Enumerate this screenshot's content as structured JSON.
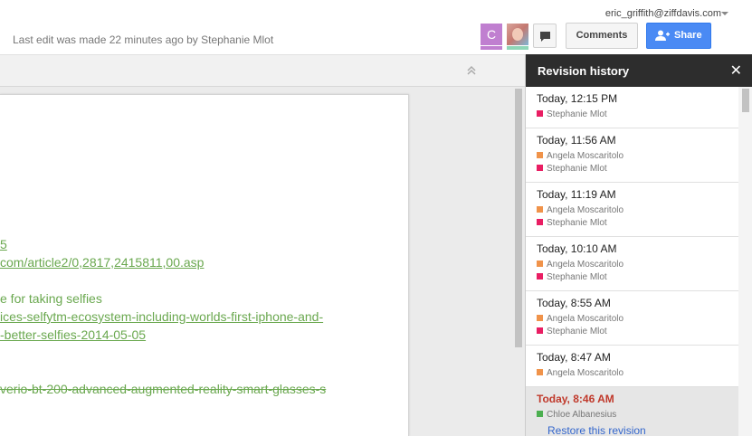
{
  "header": {
    "last_edit": "Last edit was made 22 minutes ago by Stephanie Mlot",
    "user_email": "eric_griffith@ziffdavis.com",
    "avatar_initial": "C",
    "comments_label": "Comments",
    "share_label": "Share"
  },
  "document": {
    "lines": [
      {
        "text": "5",
        "style": "link"
      },
      {
        "text": "com/article2/0,2817,2415811,00.asp",
        "style": "link"
      },
      {
        "text": "e for taking selfies",
        "style": "plain"
      },
      {
        "text": "ices-selfytm-ecosystem-including-worlds-first-iphone-and-",
        "style": "link"
      },
      {
        "text": "-better-selfies-2014-05-05",
        "style": "link"
      },
      {
        "text": "verio-bt-200-advanced-augmented-reality-smart-glasses-s",
        "style": "strike"
      }
    ]
  },
  "revision_panel": {
    "title": "Revision history",
    "close": "✕",
    "restore_label": "Restore this revision",
    "revisions": [
      {
        "time": "Today, 12:15 PM",
        "authors": [
          {
            "name": "Stephanie Mlot",
            "color": "#e91e63"
          }
        ]
      },
      {
        "time": "Today, 11:56 AM",
        "authors": [
          {
            "name": "Angela Moscaritolo",
            "color": "#f0934a"
          },
          {
            "name": "Stephanie Mlot",
            "color": "#e91e63"
          }
        ]
      },
      {
        "time": "Today, 11:19 AM",
        "authors": [
          {
            "name": "Angela Moscaritolo",
            "color": "#f0934a"
          },
          {
            "name": "Stephanie Mlot",
            "color": "#e91e63"
          }
        ]
      },
      {
        "time": "Today, 10:10 AM",
        "authors": [
          {
            "name": "Angela Moscaritolo",
            "color": "#f0934a"
          },
          {
            "name": "Stephanie Mlot",
            "color": "#e91e63"
          }
        ]
      },
      {
        "time": "Today, 8:55 AM",
        "authors": [
          {
            "name": "Angela Moscaritolo",
            "color": "#f0934a"
          },
          {
            "name": "Stephanie Mlot",
            "color": "#e91e63"
          }
        ]
      },
      {
        "time": "Today, 8:47 AM",
        "authors": [
          {
            "name": "Angela Moscaritolo",
            "color": "#f0934a"
          }
        ]
      },
      {
        "time": "Today, 8:46 AM",
        "authors": [
          {
            "name": "Chloe Albanesius",
            "color": "#4caf50"
          }
        ],
        "selected": true
      }
    ]
  },
  "colors": {
    "share_blue": "#4a8af4",
    "doc_text_green": "#6aa84f",
    "selected_time_red": "#c0392b"
  }
}
